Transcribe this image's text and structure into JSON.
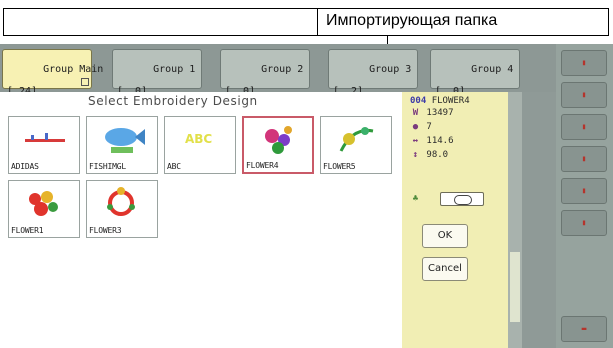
{
  "annotation": {
    "label": "Импортирующая папка"
  },
  "tabs": [
    {
      "name": "Group Main",
      "count": "[ 24]",
      "active": true
    },
    {
      "name": "Group 1",
      "count": "[  0]",
      "active": false
    },
    {
      "name": "Group 2",
      "count": "[  0]",
      "active": false
    },
    {
      "name": "Group 3",
      "count": "[  2]",
      "active": false
    },
    {
      "name": "Group 4",
      "count": "[  0]",
      "active": false
    }
  ],
  "main": {
    "title": "Select Embroidery Design"
  },
  "designs": [
    {
      "label": "ADIDAS",
      "selected": false
    },
    {
      "label": "FISHIMGL",
      "selected": false
    },
    {
      "label": "ABC",
      "selected": false
    },
    {
      "label": "FLOWER4",
      "selected": true
    },
    {
      "label": "FLOWER5",
      "selected": false
    },
    {
      "label": "FLOWER1",
      "selected": false
    },
    {
      "label": "FLOWER3",
      "selected": false
    }
  ],
  "info": {
    "badge": "004",
    "name": "FLOWER4",
    "stitches": "13497",
    "colors": "7",
    "width": "114.6",
    "height": "98.0"
  },
  "buttons": {
    "ok": "OK",
    "cancel": "Cancel"
  },
  "colors": {
    "active_tab": "#f7f1b3",
    "info_panel": "#f1eeb4",
    "selected_border": "#c95a68",
    "chrome": "#8f9a97"
  }
}
